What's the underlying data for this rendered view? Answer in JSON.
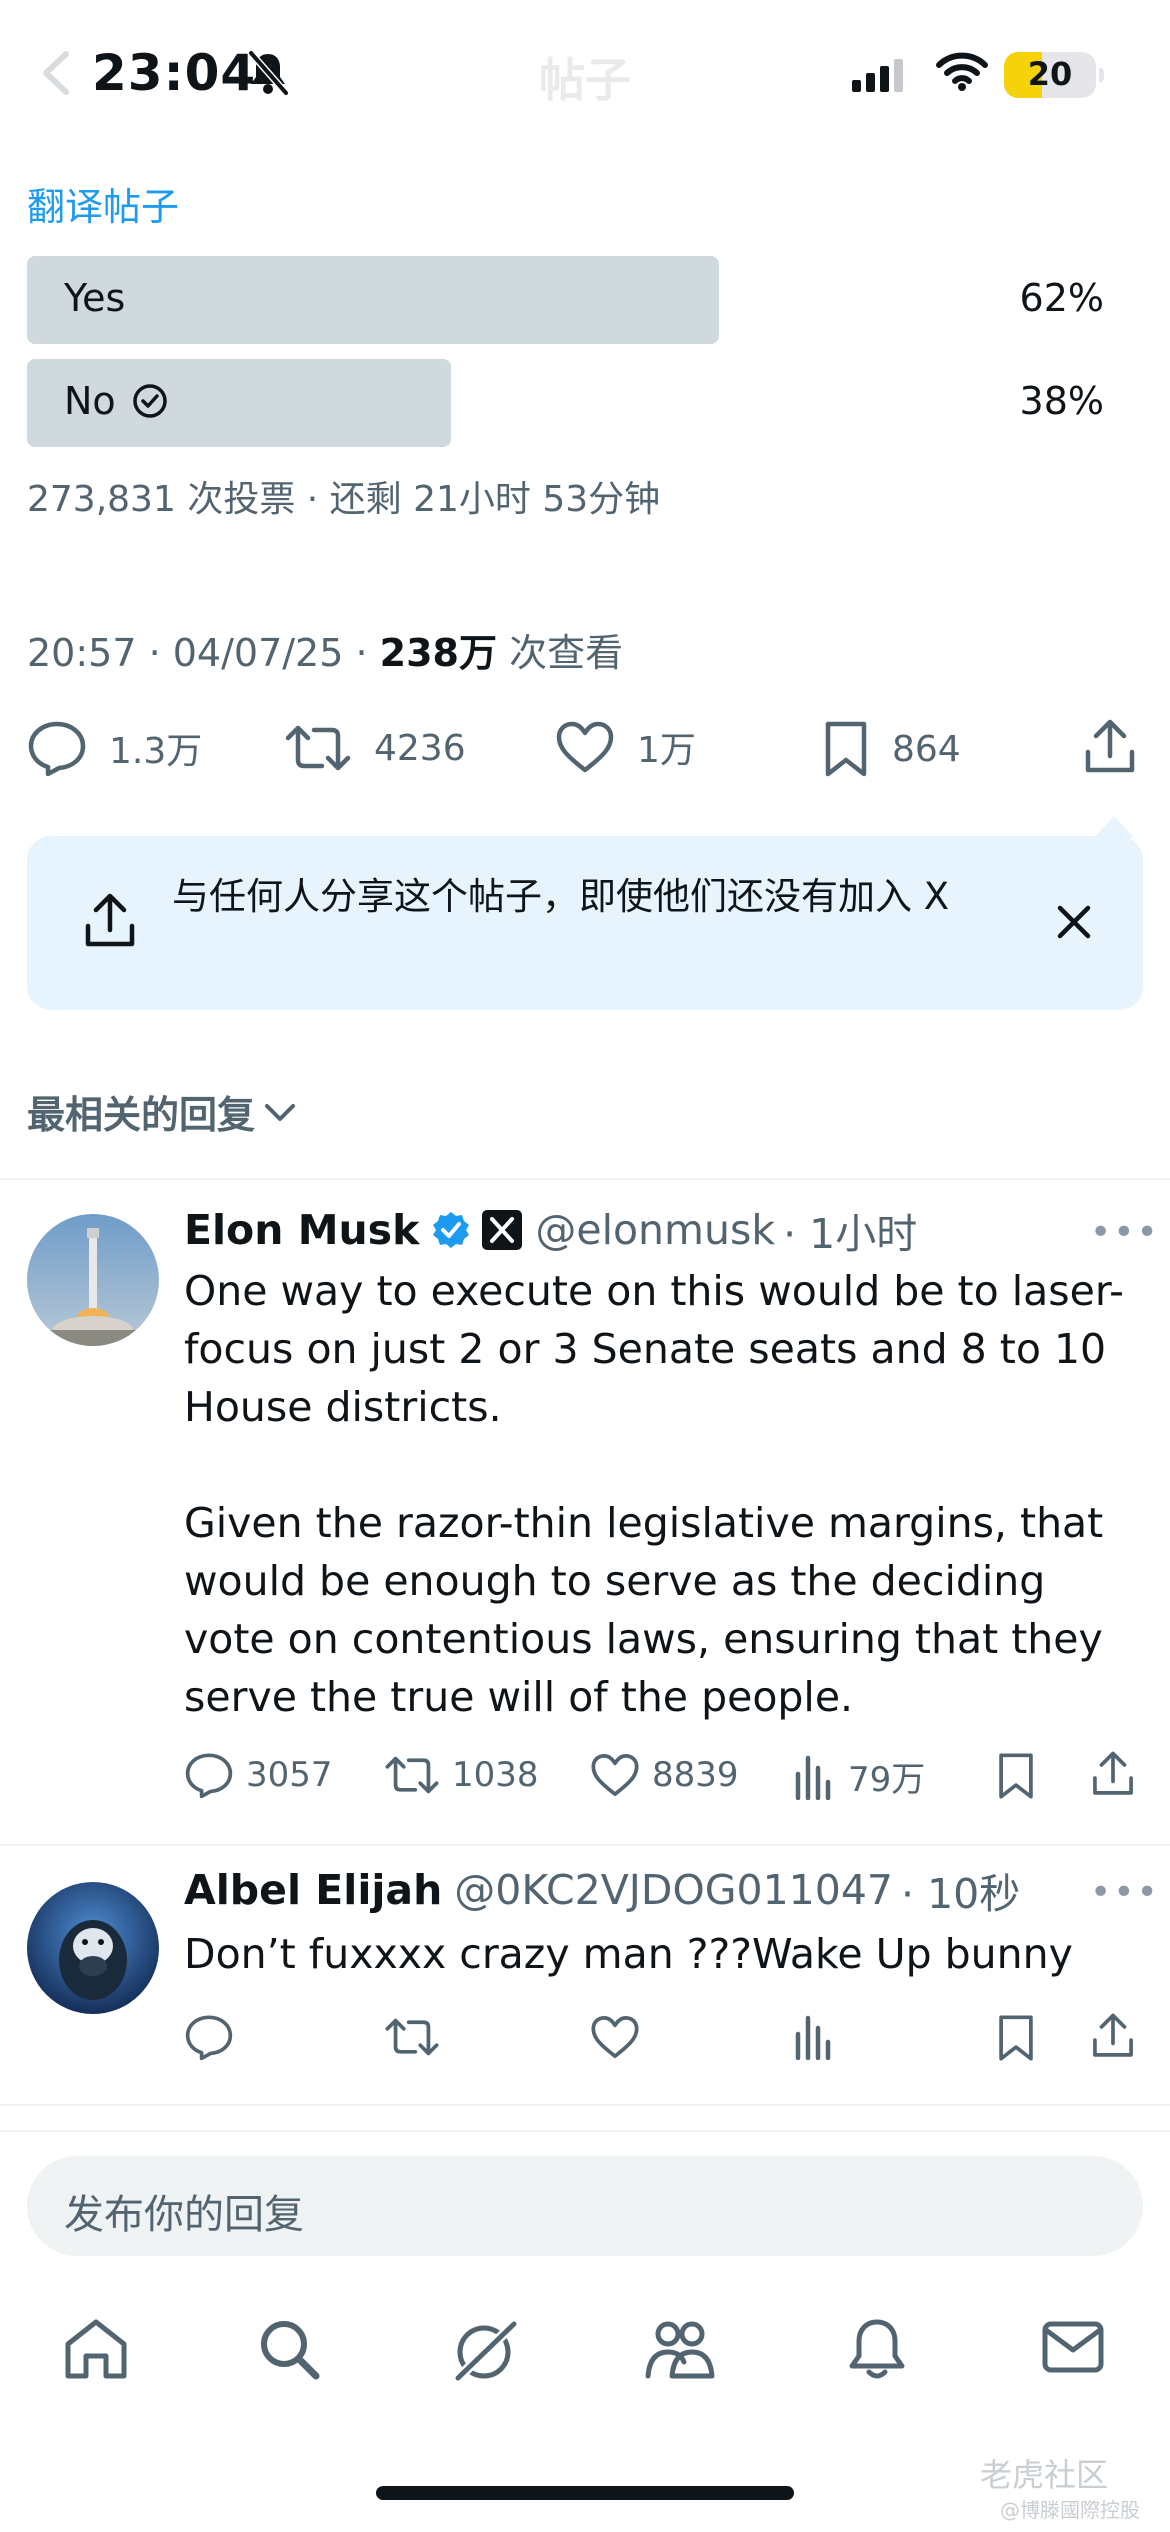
{
  "status_bar": {
    "time": "23:04",
    "battery": "20",
    "nav_title": "帖子"
  },
  "post": {
    "translate_link": "翻译帖子",
    "poll": {
      "options": [
        {
          "label": "Yes",
          "percent": "62%",
          "fraction": 0.62,
          "selected": false
        },
        {
          "label": "No",
          "percent": "38%",
          "fraction": 0.38,
          "selected": true
        }
      ],
      "meta": "273,831 次投票 · 还剩 21小时 53分钟"
    },
    "timestamp": "20:57 · 04/07/25 · ",
    "views_count": "238万",
    "views_label": " 次查看",
    "actions": {
      "replies": "1.3万",
      "reposts": "4236",
      "likes": "1万",
      "bookmarks": "864"
    }
  },
  "share_banner": {
    "text": "与任何人分享这个帖子，即使他们还没有加入 X"
  },
  "replies_header": "最相关的回复",
  "replies": [
    {
      "name": "Elon Musk",
      "handle": "@elonmusk",
      "time": "· 1小时",
      "verified": true,
      "body": "One way to execute on this would be to laser-focus on just 2 or 3 Senate seats and 8 to 10 House districts.\n\nGiven the razor-thin legislative margins, that would be enough to serve as the deciding vote on contentious laws, ensuring that they serve the true will of the people.",
      "replies": "3057",
      "reposts": "1038",
      "likes": "8839",
      "views": "79万"
    },
    {
      "name": "Albel Elijah",
      "handle": "@0KC2VJDOG011047",
      "time": "· 10秒",
      "verified": false,
      "body": "Don’t fuxxxx crazy man ???Wake Up bunny",
      "replies": "",
      "reposts": "",
      "likes": "",
      "views": ""
    }
  ],
  "reply_input": {
    "placeholder": "发布你的回复"
  },
  "watermark": {
    "line1": "老虎社区",
    "line2": "@博滕國際控股"
  },
  "colors": {
    "accent": "#1d9bf0",
    "text_primary": "#0f1419",
    "text_secondary": "#536471",
    "poll_bar": "#cfd9de",
    "share_banner_bg": "#e7f4fd"
  }
}
